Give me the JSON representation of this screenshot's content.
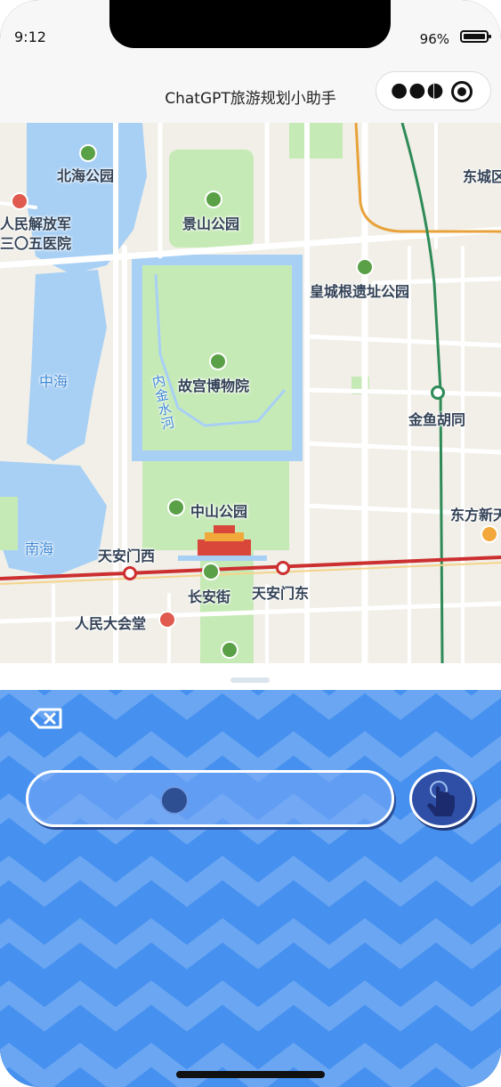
{
  "status_bar": {
    "time": "9:12",
    "battery": "96%"
  },
  "nav": {
    "title": "ChatGPT旅游规划小助手"
  },
  "map": {
    "labels": {
      "beihai": "北海公园",
      "jingshan": "景山公园",
      "hospital_1": "人民解放军",
      "hospital_2": "三〇五医院",
      "huangcheng": "皇城根遗址公园",
      "zhonghai": "中海",
      "gugong": "故宫博物院",
      "neijinshuihe": "内金水河",
      "jinyu": "金鱼胡同",
      "zhongshan": "中山公园",
      "nanhai": "南海",
      "tiananmen_west": "天安门西",
      "dongfang": "东方新天",
      "changan": "长安街",
      "tiananmen_east": "天安门东",
      "renda": "人民大会堂",
      "dongcheng": "东城区"
    }
  },
  "input": {
    "value": ""
  },
  "icons": {
    "backspace": "backspace-icon",
    "tap": "tap-hand-icon",
    "more": "more-icon",
    "close": "target-close-icon"
  },
  "colors": {
    "panel": "#4690ef",
    "park": "#c6eab6",
    "water": "#a8d0f5",
    "road_red": "#cc2f2f"
  }
}
